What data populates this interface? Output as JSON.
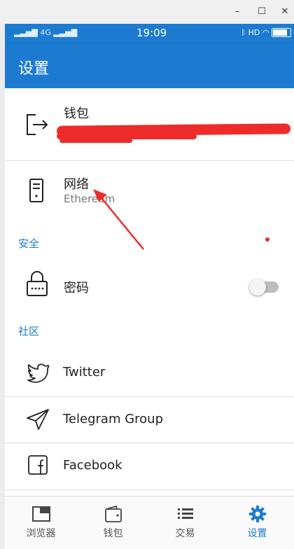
{
  "window": {
    "minimize_glyph": "–",
    "maximize_glyph": "☐",
    "close_glyph": "✕"
  },
  "status_bar": {
    "left": "4G",
    "time": "19:09",
    "right": "HD"
  },
  "header": {
    "title": "设置"
  },
  "wallet_row": {
    "label": "钱包",
    "icon": "logout-icon"
  },
  "network_row": {
    "label": "网络",
    "sublabel": "Ethereum",
    "icon": "server-icon"
  },
  "security_section": {
    "title": "安全"
  },
  "password_row": {
    "label": "密码",
    "icon": "lock-icon",
    "toggle_on": false
  },
  "community_section": {
    "title": "社区"
  },
  "community_rows": [
    {
      "label": "Twitter",
      "icon": "twitter-icon"
    },
    {
      "label": "Telegram Group",
      "icon": "telegram-icon"
    },
    {
      "label": "Facebook",
      "icon": "facebook-icon"
    }
  ],
  "bottom_nav": [
    {
      "label": "浏览器",
      "icon": "browser-icon",
      "active": false
    },
    {
      "label": "钱包",
      "icon": "wallet-icon",
      "active": false
    },
    {
      "label": "交易",
      "icon": "list-icon",
      "active": false
    },
    {
      "label": "设置",
      "icon": "gear-icon",
      "active": true
    }
  ],
  "colors": {
    "primary": "#1c7bd0",
    "redaction": "#ee2b2b",
    "annotation_dot": "#ee2b2b"
  }
}
